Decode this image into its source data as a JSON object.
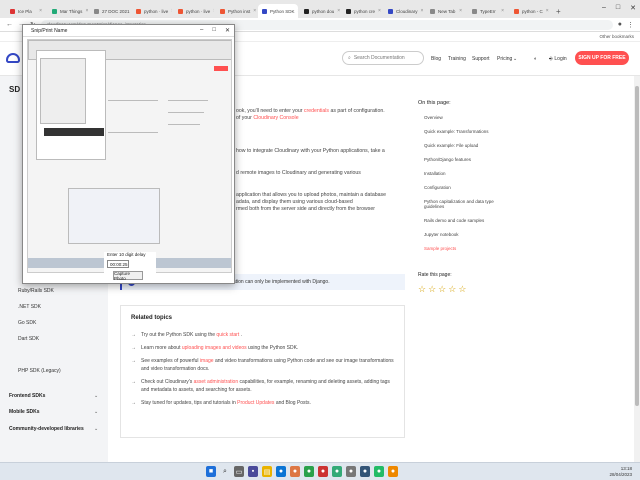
{
  "browser": {
    "tabs": [
      {
        "label": "Ice Pla",
        "color": "#d33"
      },
      {
        "label": "Mar Things",
        "color": "#2a7"
      },
      {
        "label": "27 DOC 2021",
        "color": "#888"
      },
      {
        "label": "python · live",
        "color": "#e53"
      },
      {
        "label": "python · live",
        "color": "#e53"
      },
      {
        "label": "Python inst",
        "color": "#e53"
      },
      {
        "label": "Python SDK",
        "color": "#3448c5",
        "active": true
      },
      {
        "label": "python dou",
        "color": "#222"
      },
      {
        "label": "python cre",
        "color": "#222"
      },
      {
        "label": "Cloudinary",
        "color": "#3448c5"
      },
      {
        "label": "New Tab",
        "color": "#888"
      },
      {
        "label": "TypeErr",
        "color": "#888"
      },
      {
        "label": "python - C",
        "color": "#e53"
      }
    ],
    "url": "cloudinary.com/documentation/django_integration",
    "bookmarks_other": "Other bookmarks"
  },
  "header": {
    "search_placeholder": "Search Documentation",
    "nav": [
      "Blog",
      "Training",
      "Support",
      "Pricing"
    ],
    "login": "Login",
    "signup": "SIGN UP FOR FREE"
  },
  "sidebar": {
    "top_item": "SD",
    "items": [
      "Ruby/Rails SDK",
      ".NET SDK",
      "Go SDK",
      "Dart SDK",
      "PHP SDK (Legacy)"
    ],
    "groups": [
      "Frontend SDKs",
      "Mobile SDKs",
      "Community-developed libraries"
    ]
  },
  "main": {
    "line1_a": "ook, you'll need to enter your",
    "line1_link": "credentials",
    "line1_b": "as part of configuration.",
    "line2_a": "of your",
    "line2_link": "Cloudinary Console",
    "line3": "how to integrate Cloudinary with your Python applications, take a",
    "line4": "d remote images to Cloudinary and generating various",
    "line5": "application that allows you to upload photos, maintain a database",
    "line6": "adata, and display them using various cloud-based",
    "line7": "rmed both from the server side and directly from the browser",
    "note": "Note: The Django Photo Album web application can only be implemented with Django."
  },
  "related": {
    "title": "Related topics",
    "items": [
      {
        "text": "Try out the Python SDK using the",
        "link": "quick start",
        "after": "."
      },
      {
        "text": "Learn more about",
        "link": "uploading images and videos",
        "after": "using the Python SDK."
      },
      {
        "text": "See examples of powerful",
        "link": "image",
        "after": "and video transformations using Python code and see our image transformations and video transformation docs."
      },
      {
        "text": "Check out Cloudinary's",
        "link": "asset administration",
        "after": "capabilities, for example, renaming and deleting assets, adding tags and metadata to assets, and searching for assets."
      },
      {
        "text": "Stay tuned for updates, tips and tutorials in",
        "link": "Product Updates",
        "after": "and Blog Posts."
      }
    ]
  },
  "on_this_page": {
    "title": "On this page:",
    "items": [
      "Overview",
      "Quick example: Transformations",
      "Quick example: File upload",
      "Python/Django features",
      "Installation",
      "Configuration",
      "Python capitalization and data type guidelines",
      "Rails demo and code samples",
      "Jupyter notebook",
      "Sample projects"
    ],
    "selected_index": 9
  },
  "rate": {
    "title": "Rate this page:",
    "stars": 5
  },
  "snip": {
    "title": "Snip/Print Name",
    "delay_label": "Enter 10 digit delay",
    "delay_value": "00:00:25",
    "capture_label": "Capture Photo"
  },
  "taskbar": {
    "time": "13:18",
    "date": "28/04/2023"
  }
}
